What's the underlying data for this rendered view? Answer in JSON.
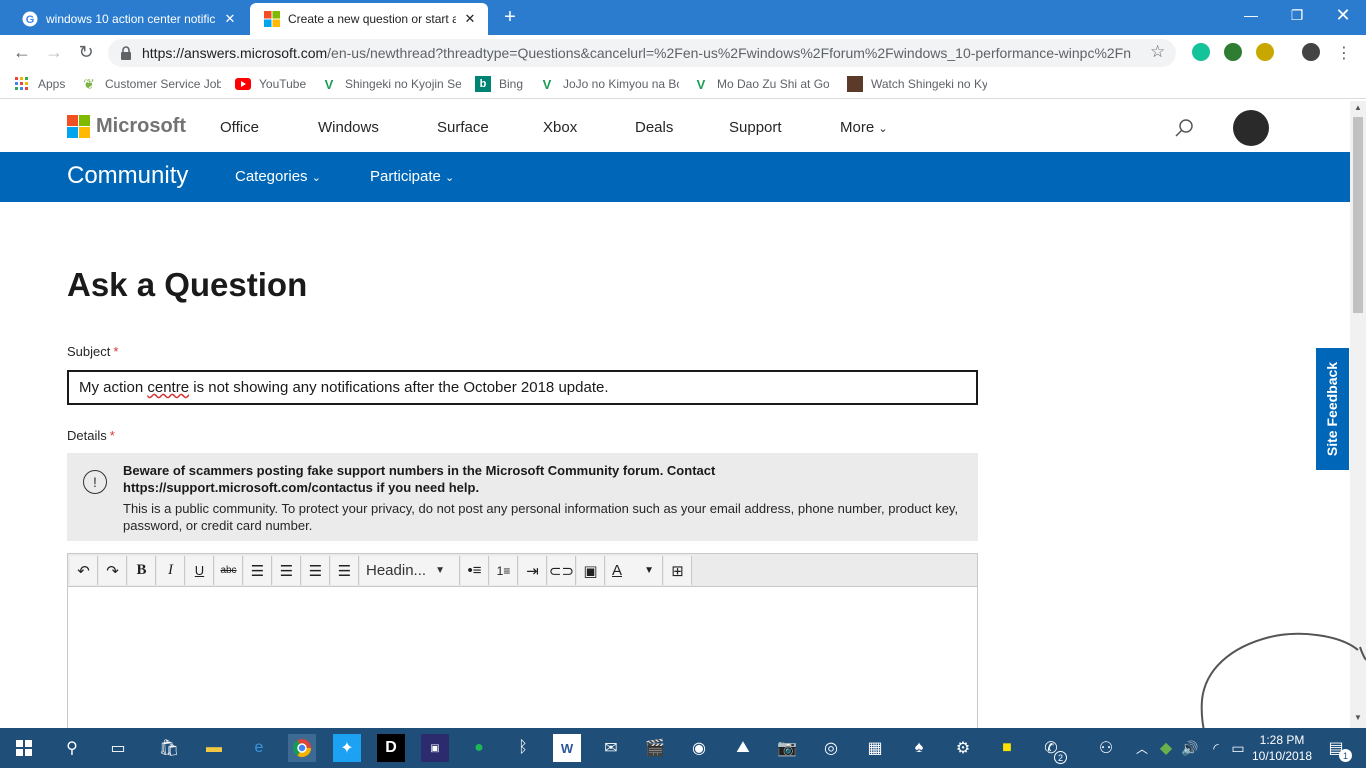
{
  "browser": {
    "tabs": [
      {
        "title": "windows 10 action center notific",
        "active": false
      },
      {
        "title": "Create a new question or start a",
        "active": true
      }
    ],
    "new_tab_label": "+",
    "url_host": "https://answers.microsoft.com",
    "url_rest": "/en-us/newthread?threadtype=Questions&cancelurl=%2Fen-us%2Fwindows%2Fforum%2Fwindows_10-performance-winpc%2Fn...",
    "bookmarks": [
      {
        "label": "Apps",
        "icon": "apps-grid-icon"
      },
      {
        "label": "Customer Service Job",
        "icon": "leaf-icon"
      },
      {
        "label": "YouTube",
        "icon": "youtube-icon"
      },
      {
        "label": "Shingeki no Kyojin Se",
        "icon": "tv-icon"
      },
      {
        "label": "Bing",
        "icon": "bing-icon"
      },
      {
        "label": "JoJo no Kimyou na Bo",
        "icon": "tv-icon"
      },
      {
        "label": "Mo Dao Zu Shi at Go",
        "icon": "tv-icon"
      },
      {
        "label": "Watch Shingeki no Ky",
        "icon": "anime-icon"
      }
    ]
  },
  "header": {
    "brand": "Microsoft",
    "nav": [
      "Office",
      "Windows",
      "Surface",
      "Xbox",
      "Deals",
      "Support",
      "More"
    ]
  },
  "community": {
    "title": "Community",
    "nav": [
      "Categories",
      "Participate"
    ]
  },
  "form": {
    "title": "Ask a Question",
    "subject_label": "Subject",
    "required_mark": "*",
    "subject_before": "My action ",
    "subject_misspelled": "centre",
    "subject_after": " is not showing any notifications after the October 2018 update.",
    "details_label": "Details",
    "notice_bold": "Beware of scammers posting fake support numbers in the Microsoft Community forum. Contact https://support.microsoft.com/contactus if you need help.",
    "notice_text": "This is a public community. To protect your privacy, do not post any personal information such as your email address, phone number, product key, password, or credit card number.",
    "heading_select": "Headin..."
  },
  "site_feedback": "Site Feedback",
  "taskbar": {
    "time": "1:28 PM",
    "date": "10/10/2018",
    "notification_count": "1",
    "mail_badge": "2"
  },
  "colors": {
    "chrome_blue": "#2b7ccf",
    "ms_blue": "#0067b8",
    "taskbar": "#1f4e79"
  }
}
